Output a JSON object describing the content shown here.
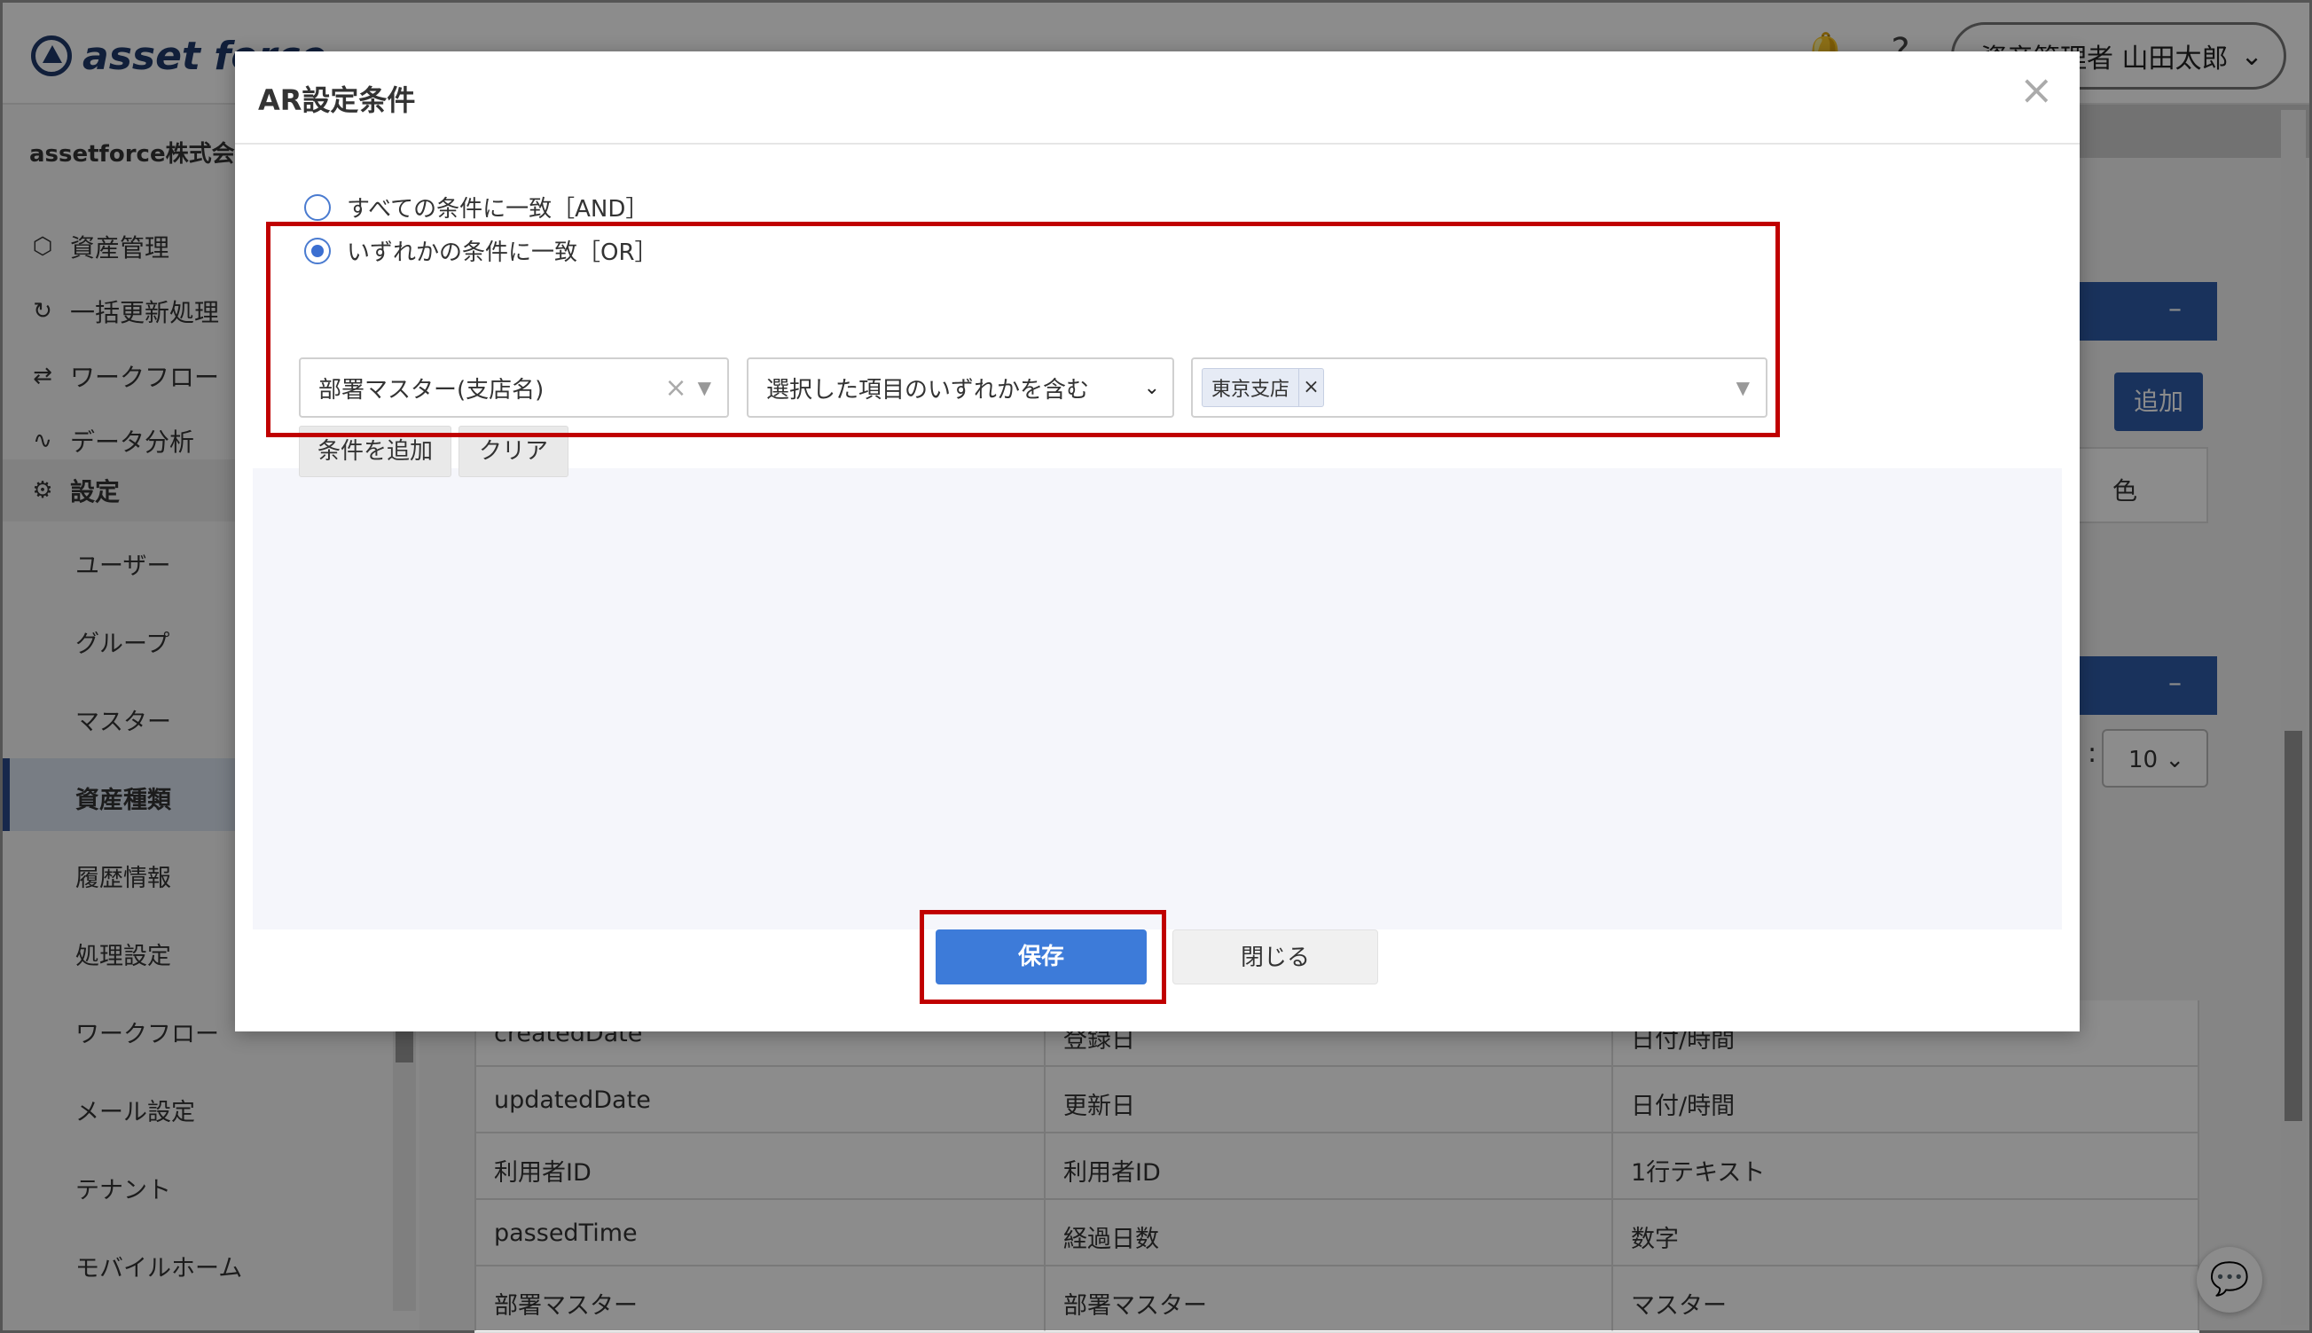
{
  "app": {
    "brand": "asset force",
    "user_label": "資産管理者 山田太郎",
    "icons": [
      "bell-icon",
      "help-icon",
      "chevron-down-icon"
    ]
  },
  "sidebar": {
    "company": "assetforce株式会社",
    "main_items": [
      {
        "label": "資産管理",
        "icon": "cube-icon"
      },
      {
        "label": "一括更新処理",
        "icon": "refresh-icon"
      },
      {
        "label": "ワークフロー",
        "icon": "workflow-icon"
      },
      {
        "label": "データ分析",
        "icon": "analytics-icon"
      },
      {
        "label": "設定",
        "icon": "gear-icon"
      }
    ],
    "sub_items": [
      "ユーザー",
      "グループ",
      "マスター",
      "資産種類",
      "履歴情報",
      "処理設定",
      "ワークフロー",
      "メール設定",
      "テナント",
      "モバイルホーム"
    ],
    "active_sub": "資産種類"
  },
  "content": {
    "add_label": "追加",
    "color_header": "色",
    "collapse_label": "–",
    "per_page": "10",
    "table_rows": [
      [
        "createdDate",
        "登録日",
        "日付/時間"
      ],
      [
        "updatedDate",
        "更新日",
        "日付/時間"
      ],
      [
        "利用者ID",
        "利用者ID",
        "1行テキスト"
      ],
      [
        "passedTime",
        "経過日数",
        "数字"
      ],
      [
        "部署マスター",
        "部署マスター",
        "マスター"
      ]
    ]
  },
  "modal": {
    "title": "AR設定条件",
    "close_symbol": "×",
    "radio_and": "すべての条件に一致［AND］",
    "radio_or": "いずれかの条件に一致［OR］",
    "selected_mode": "OR",
    "field_select": "部署マスター(支店名)",
    "operator_select": "選択した項目のいずれかを含む",
    "value_tags": [
      "東京支店"
    ],
    "add_condition": "条件を追加",
    "clear": "クリア",
    "save": "保存",
    "close": "閉じる"
  },
  "colors": {
    "primary": "#3d7bd9",
    "highlight": "#c00000",
    "navy": "#2f5ca8"
  }
}
